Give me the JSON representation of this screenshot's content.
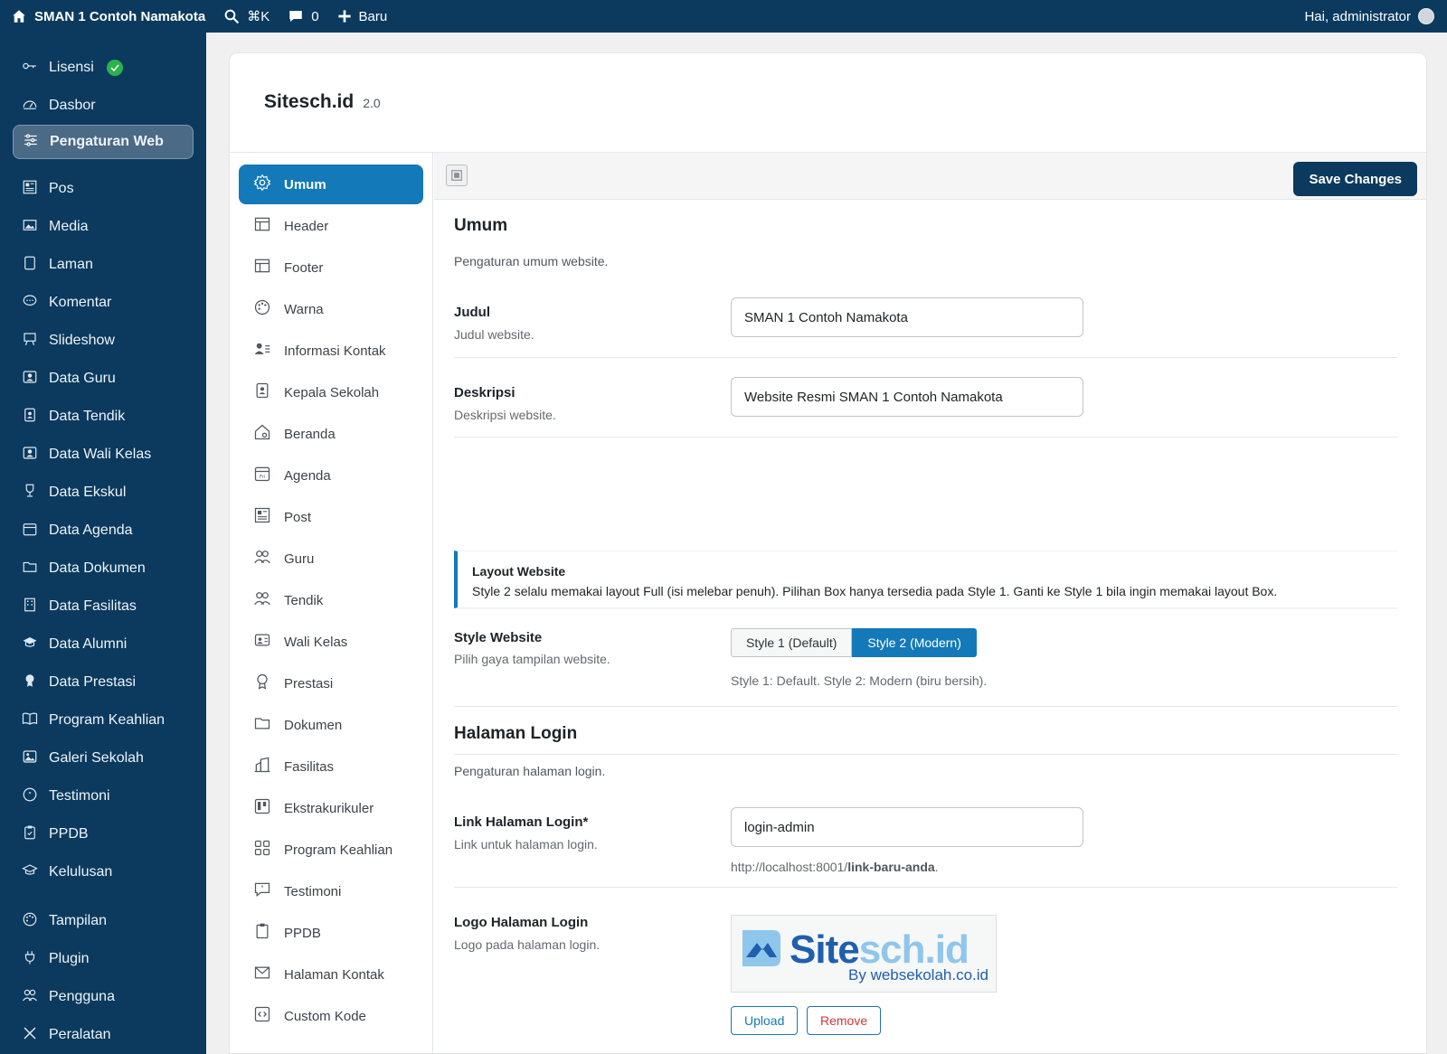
{
  "topbar": {
    "site_name": "SMAN 1 Contoh Namakota",
    "search_shortcut": "⌘K",
    "comments_count": "0",
    "new_label": "Baru",
    "greeting": "Hai, administrator"
  },
  "sidebar": {
    "items": [
      {
        "label": "Lisensi",
        "icon": "key-icon"
      },
      {
        "label": "Dasbor",
        "icon": "dashboard-icon"
      },
      {
        "label": "Pengaturan Web",
        "icon": "settings-sliders-icon"
      },
      {
        "label": "Pos",
        "icon": "post-icon"
      },
      {
        "label": "Media",
        "icon": "media-icon"
      },
      {
        "label": "Laman",
        "icon": "page-icon"
      },
      {
        "label": "Komentar",
        "icon": "comment-icon"
      },
      {
        "label": "Slideshow",
        "icon": "slideshow-icon"
      },
      {
        "label": "Data Guru",
        "icon": "id-card-icon"
      },
      {
        "label": "Data Tendik",
        "icon": "badge-icon"
      },
      {
        "label": "Data Wali Kelas",
        "icon": "id-card-icon"
      },
      {
        "label": "Data Ekskul",
        "icon": "trophy-icon"
      },
      {
        "label": "Data Agenda",
        "icon": "calendar-icon"
      },
      {
        "label": "Data Dokumen",
        "icon": "folder-icon"
      },
      {
        "label": "Data Fasilitas",
        "icon": "building-icon"
      },
      {
        "label": "Data Alumni",
        "icon": "graduation-cap-icon"
      },
      {
        "label": "Data Prestasi",
        "icon": "award-icon"
      },
      {
        "label": "Program Keahlian",
        "icon": "book-icon"
      },
      {
        "label": "Galeri Sekolah",
        "icon": "image-icon"
      },
      {
        "label": "Testimoni",
        "icon": "quote-icon"
      },
      {
        "label": "PPDB",
        "icon": "clipboard-icon"
      },
      {
        "label": "Kelulusan",
        "icon": "graduation-icon"
      },
      {
        "label": "Tampilan",
        "icon": "palette-icon"
      },
      {
        "label": "Plugin",
        "icon": "plug-icon"
      },
      {
        "label": "Pengguna",
        "icon": "users-icon"
      },
      {
        "label": "Peralatan",
        "icon": "tools-icon"
      }
    ]
  },
  "header": {
    "title": "Sitesch.id",
    "version": "2.0"
  },
  "settings_nav": {
    "items": [
      {
        "label": "Umum",
        "icon": "gear-icon"
      },
      {
        "label": "Header",
        "icon": "layout-header-icon"
      },
      {
        "label": "Footer",
        "icon": "layout-footer-icon"
      },
      {
        "label": "Warna",
        "icon": "palette-icon"
      },
      {
        "label": "Informasi Kontak",
        "icon": "contact-icon"
      },
      {
        "label": "Kepala Sekolah",
        "icon": "badge-icon"
      },
      {
        "label": "Beranda",
        "icon": "home-icon"
      },
      {
        "label": "Agenda",
        "icon": "calendar-icon"
      },
      {
        "label": "Post",
        "icon": "post-icon"
      },
      {
        "label": "Guru",
        "icon": "users-icon"
      },
      {
        "label": "Tendik",
        "icon": "users-icon"
      },
      {
        "label": "Wali Kelas",
        "icon": "id-card-icon"
      },
      {
        "label": "Prestasi",
        "icon": "award-icon"
      },
      {
        "label": "Dokumen",
        "icon": "folder-icon"
      },
      {
        "label": "Fasilitas",
        "icon": "building-icon"
      },
      {
        "label": "Ekstrakurikuler",
        "icon": "trello-icon"
      },
      {
        "label": "Program Keahlian",
        "icon": "grid-icon"
      },
      {
        "label": "Testimoni",
        "icon": "quote-icon"
      },
      {
        "label": "PPDB",
        "icon": "clipboard-icon"
      },
      {
        "label": "Halaman Kontak",
        "icon": "envelope-icon"
      },
      {
        "label": "Custom Kode",
        "icon": "code-icon"
      }
    ]
  },
  "toolbar": {
    "save_label": "Save Changes"
  },
  "umum": {
    "title": "Umum",
    "desc": "Pengaturan umum website.",
    "judul_label": "Judul",
    "judul_help": "Judul website.",
    "judul_value": "SMAN 1 Contoh Namakota",
    "deskripsi_label": "Deskripsi",
    "deskripsi_help": "Deskripsi website.",
    "deskripsi_value": "Website Resmi SMAN 1 Contoh Namakota"
  },
  "notice": {
    "title": "Layout Website",
    "text": "Style 2 selalu memakai layout Full (isi melebar penuh). Pilihan Box hanya tersedia pada Style 1. Ganti ke Style 1 bila ingin memakai layout Box."
  },
  "style": {
    "label": "Style Website",
    "help": "Pilih gaya tampilan website.",
    "option1": "Style 1 (Default)",
    "option2": "Style 2 (Modern)",
    "selected": "Style 2 (Modern)",
    "note": "Style 1: Default. Style 2: Modern (biru bersih)."
  },
  "login": {
    "title": "Halaman Login",
    "desc": "Pengaturan halaman login.",
    "link_label": "Link Halaman Login*",
    "link_help": "Link untuk halaman login.",
    "link_value": "login-admin",
    "url_prefix": "http://localhost:8001/",
    "url_slug": "link-baru-anda",
    "url_suffix": ".",
    "logo_label": "Logo Halaman Login",
    "logo_help": "Logo pada halaman login.",
    "logo_text_a": "Site",
    "logo_text_b": "sch.id",
    "logo_sub": "By websekolah.co.id",
    "upload_label": "Upload",
    "remove_label": "Remove"
  },
  "colors": {
    "topbar_bg": "#0b3a5e",
    "accent": "#1479b8",
    "success": "#2bb24c",
    "danger": "#d63638"
  }
}
